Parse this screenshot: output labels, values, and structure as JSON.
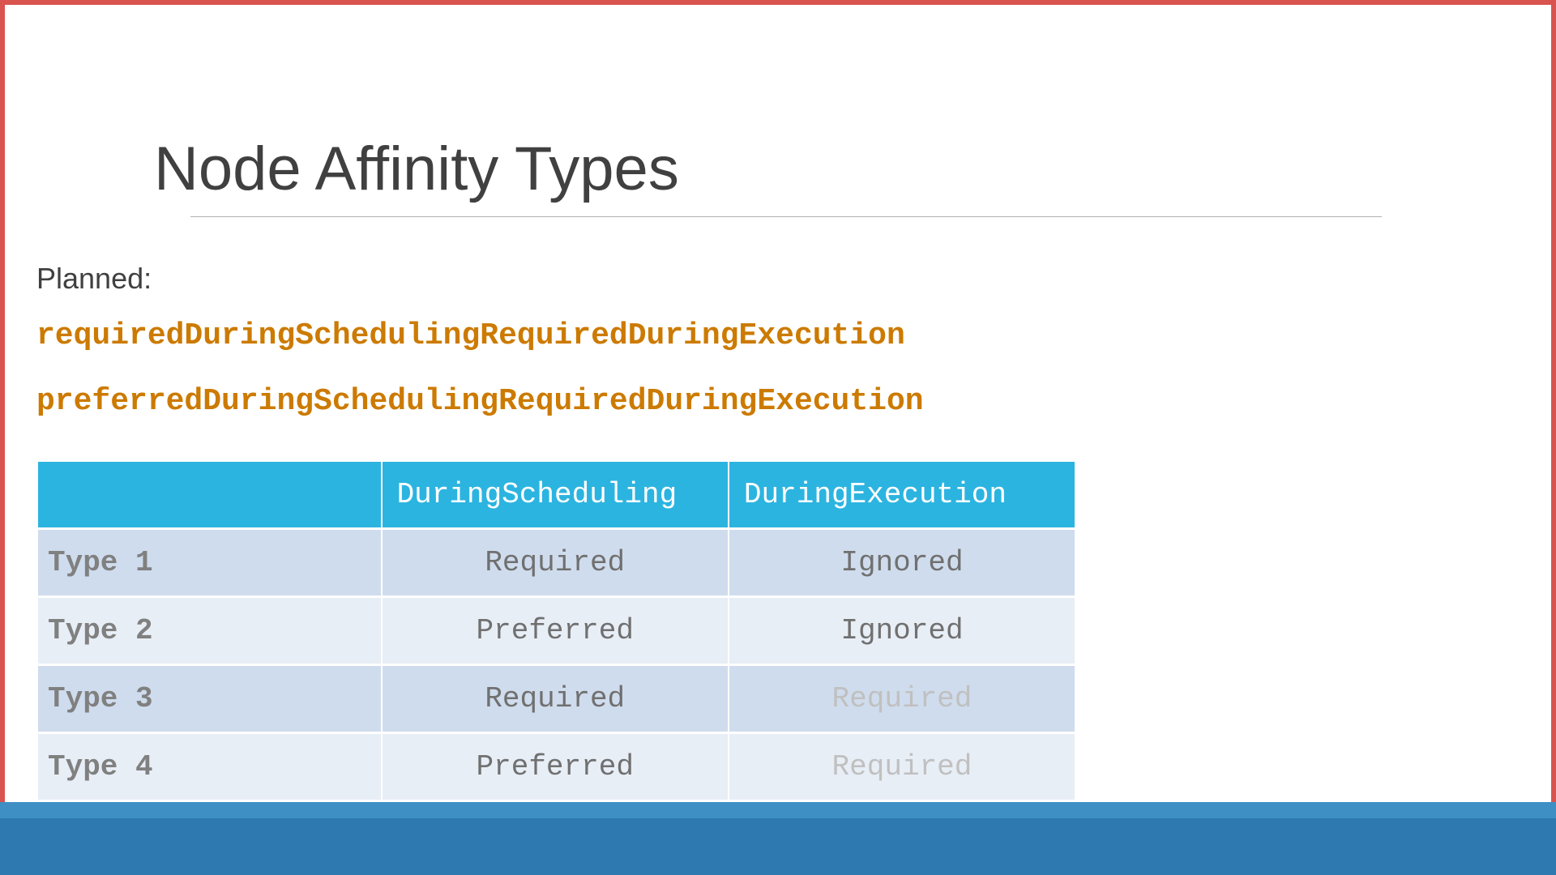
{
  "title": "Node Affinity Types",
  "planned_label": "Planned:",
  "code_line_1": "requiredDuringSchedulingRequiredDuringExecution",
  "code_line_2": "preferredDuringSchedulingRequiredDuringExecution",
  "table": {
    "headers": {
      "col1": "",
      "col2": "DuringScheduling",
      "col3": "DuringExecution"
    },
    "rows": [
      {
        "label": "Type 1",
        "scheduling": "Required",
        "execution": "Ignored",
        "execution_faded": false
      },
      {
        "label": "Type 2",
        "scheduling": "Preferred",
        "execution": "Ignored",
        "execution_faded": false
      },
      {
        "label": "Type 3",
        "scheduling": "Required",
        "execution": "Required",
        "execution_faded": true
      },
      {
        "label": "Type 4",
        "scheduling": "Preferred",
        "execution": "Required",
        "execution_faded": true
      }
    ]
  }
}
